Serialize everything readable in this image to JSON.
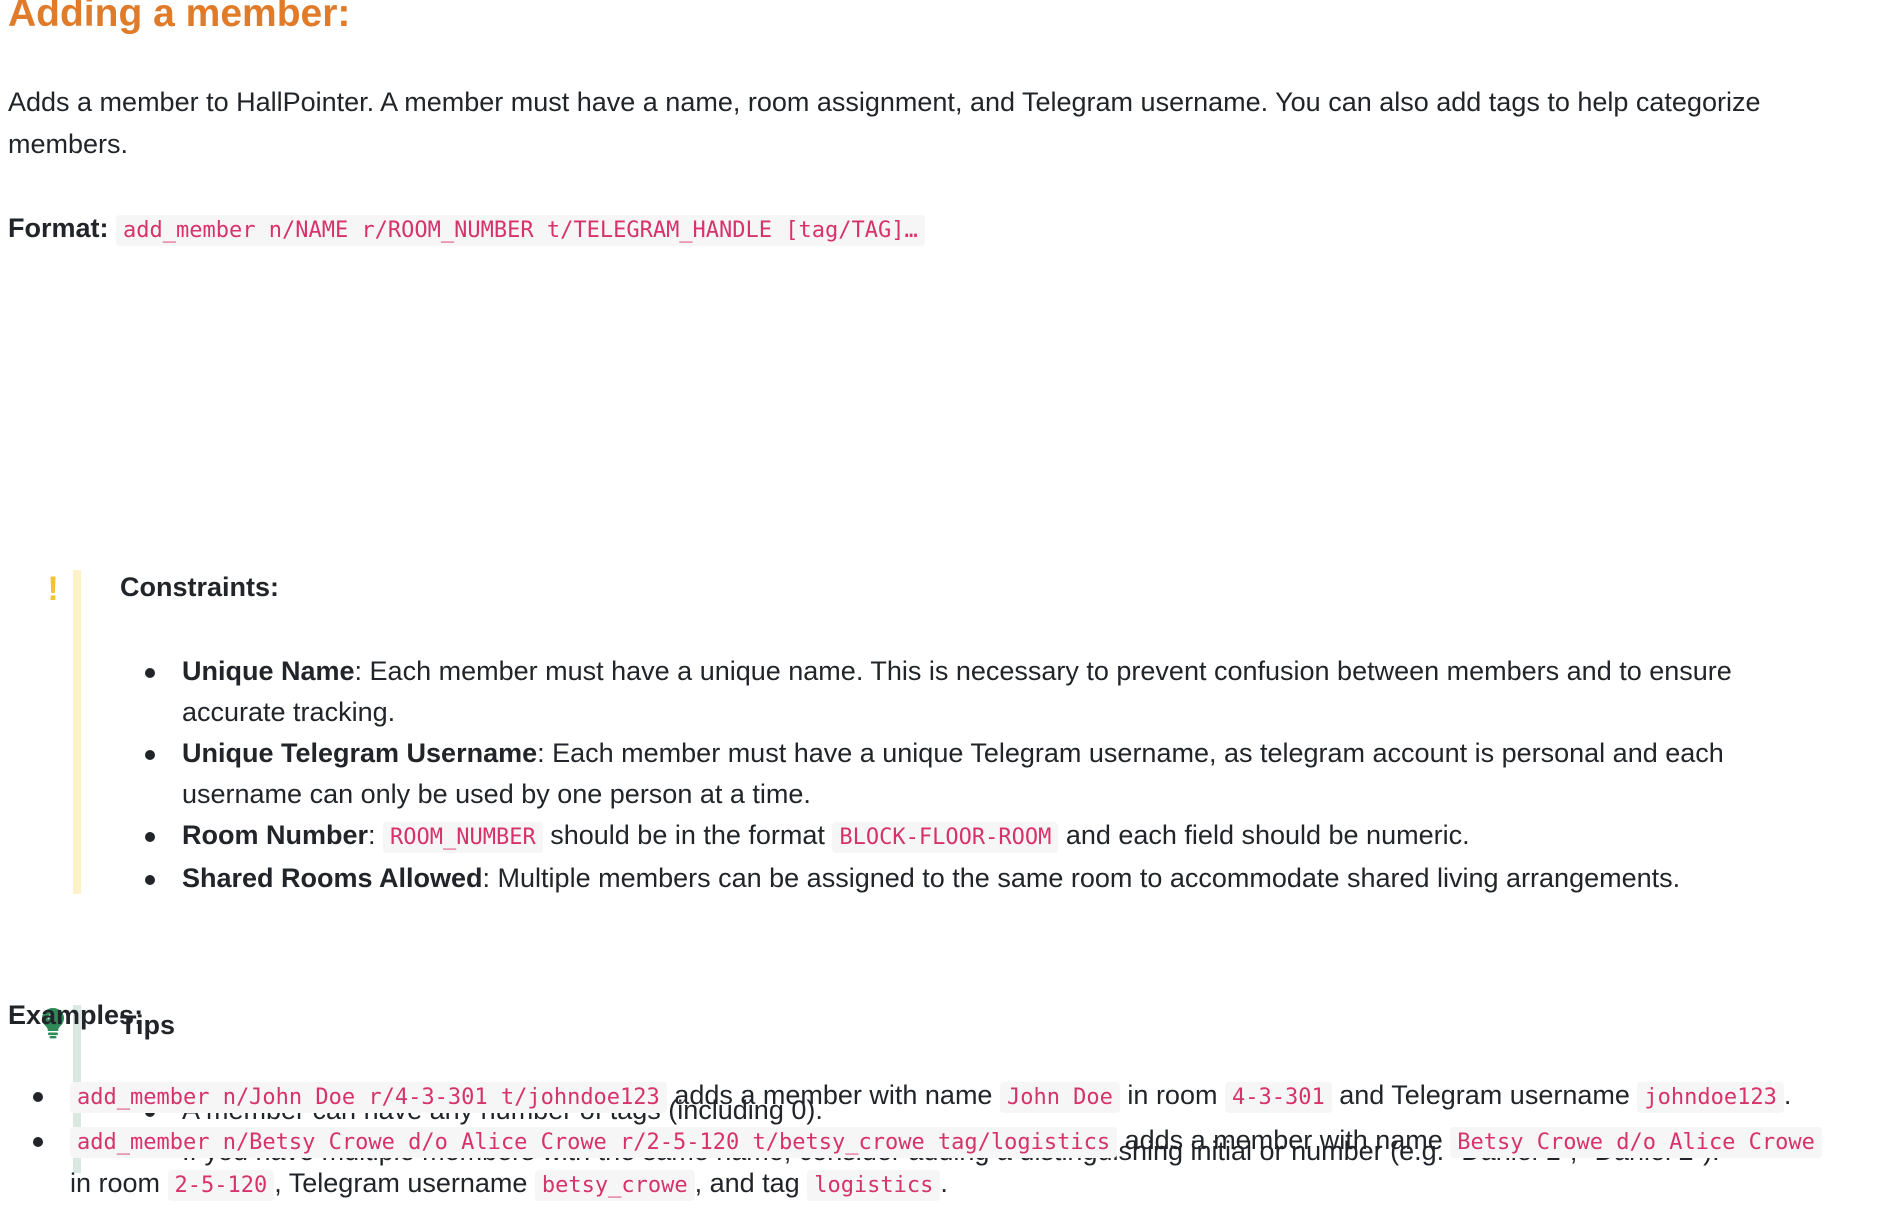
{
  "heading": "Adding a member:",
  "intro": "Adds a member to HallPointer. A member must have a name, room assignment, and Telegram username. You can also add tags to help categorize members.",
  "format": {
    "label": "Format:",
    "code": "add_member n/NAME r/ROOM_NUMBER t/TELEGRAM_HANDLE [tag/TAG]…"
  },
  "constraints": {
    "icon": "exclamation-icon",
    "icon_glyph": "!",
    "title": "Constraints:",
    "accent": "#f2c335",
    "items": [
      {
        "bold": "Unique Name",
        "text": ": Each member must have a unique name. This is necessary to prevent confusion between members and to ensure accurate tracking."
      },
      {
        "bold": "Unique Telegram Username",
        "text": ": Each member must have a unique Telegram username, as telegram account is personal and each username can only be used by one person at a time."
      },
      {
        "bold": "Room Number",
        "sep": ": ",
        "code1": "ROOM_NUMBER",
        "mid": " should be in the format ",
        "code2": "BLOCK-FLOOR-ROOM",
        "tail": " and each field should be numeric."
      },
      {
        "bold": "Shared Rooms Allowed",
        "text": ": Multiple members can be assigned to the same room to accommodate shared living arrangements."
      }
    ]
  },
  "tips": {
    "icon": "lightbulb-icon",
    "title": "Tips",
    "accent": "#2e8b57",
    "items": [
      "A member can have any number of tags (including 0).",
      "If you have multiple members with the same name, consider adding a distinguishing initial or number (e.g. \"Daniel L\", \"Daniel 2\")."
    ]
  },
  "examples": {
    "title": "Examples:",
    "items": [
      {
        "cmd": "add_member n/John Doe r/4-3-301 t/johndoe123",
        "t1": " adds a member with name ",
        "name": "John Doe",
        "t2": " in room ",
        "room": "4-3-301",
        "t3": " and Telegram username ",
        "tg": "johndoe123",
        "t4": "."
      },
      {
        "cmd": "add_member n/Betsy Crowe d/o Alice Crowe r/2-5-120 t/betsy_crowe tag/logistics",
        "t1": " adds a member with name ",
        "name": "Betsy Crowe d/o Alice Crowe",
        "t2": " in room ",
        "room": "2-5-120",
        "t3": ", Telegram username ",
        "tg": "betsy_crowe",
        "t4": ", and tag ",
        "tag": "logistics",
        "t5": "."
      }
    ]
  },
  "colors": {
    "heading": "#e07b2a",
    "code_text": "#d6336c",
    "code_bg": "#f6f6f6",
    "warn_bar": "#fdf1c7",
    "tip_bar": "#d9e9e1"
  }
}
